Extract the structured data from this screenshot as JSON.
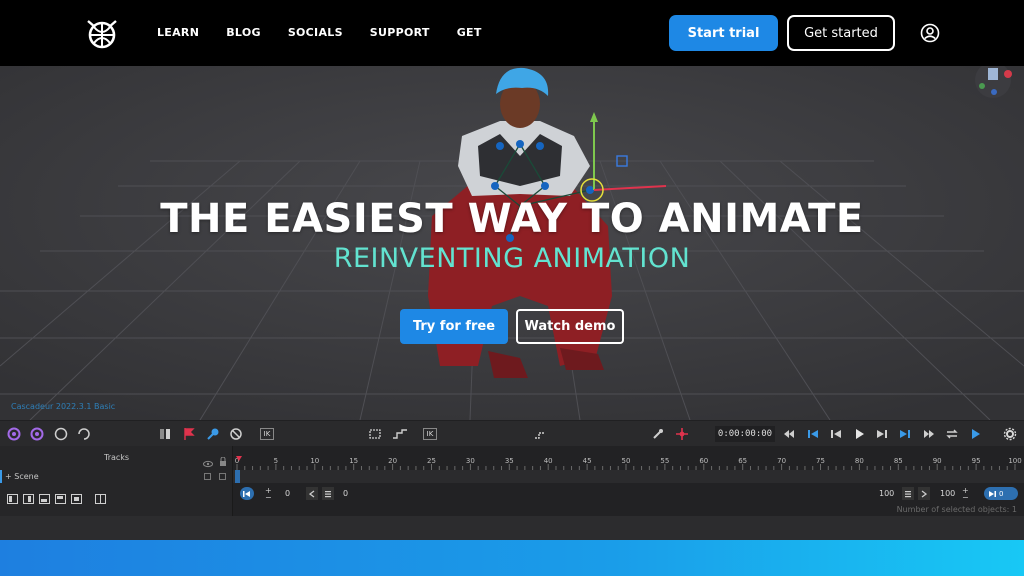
{
  "nav": {
    "links": [
      "LEARN",
      "BLOG",
      "SOCIALS",
      "SUPPORT",
      "GET"
    ],
    "start_trial": "Start trial",
    "get_started": "Get started"
  },
  "hero": {
    "title": "THE EASIEST WAY TO ANIMATE",
    "subtitle": "REINVENTING ANIMATION",
    "try_free": "Try for free",
    "watch_demo": "Watch demo"
  },
  "viewport": {
    "version": "Cascadeur 2022.3.1 Basic"
  },
  "toolbar": {
    "ik_label": "IK",
    "time": "0:00:00:00"
  },
  "timeline": {
    "tracks_label": "Tracks",
    "scene_label": "+ Scene",
    "ruler_ticks": [
      "0",
      "5",
      "10",
      "15",
      "20",
      "25",
      "30",
      "35",
      "40",
      "45",
      "50",
      "55",
      "60",
      "65",
      "70",
      "75",
      "80",
      "85",
      "90",
      "95",
      "100"
    ],
    "interval_start": "0",
    "interval_current": "0",
    "end_frame_a": "100",
    "end_frame_b": "100",
    "selected_info": "Number of selected objects: 1"
  },
  "colors": {
    "accent_blue": "#1e88e5",
    "subtitle_teal": "#62e3d0",
    "viewport_bg": "#3a3a3d"
  },
  "icons": {
    "logo": "cascadeur-logo-icon",
    "user": "user-account-icon"
  }
}
